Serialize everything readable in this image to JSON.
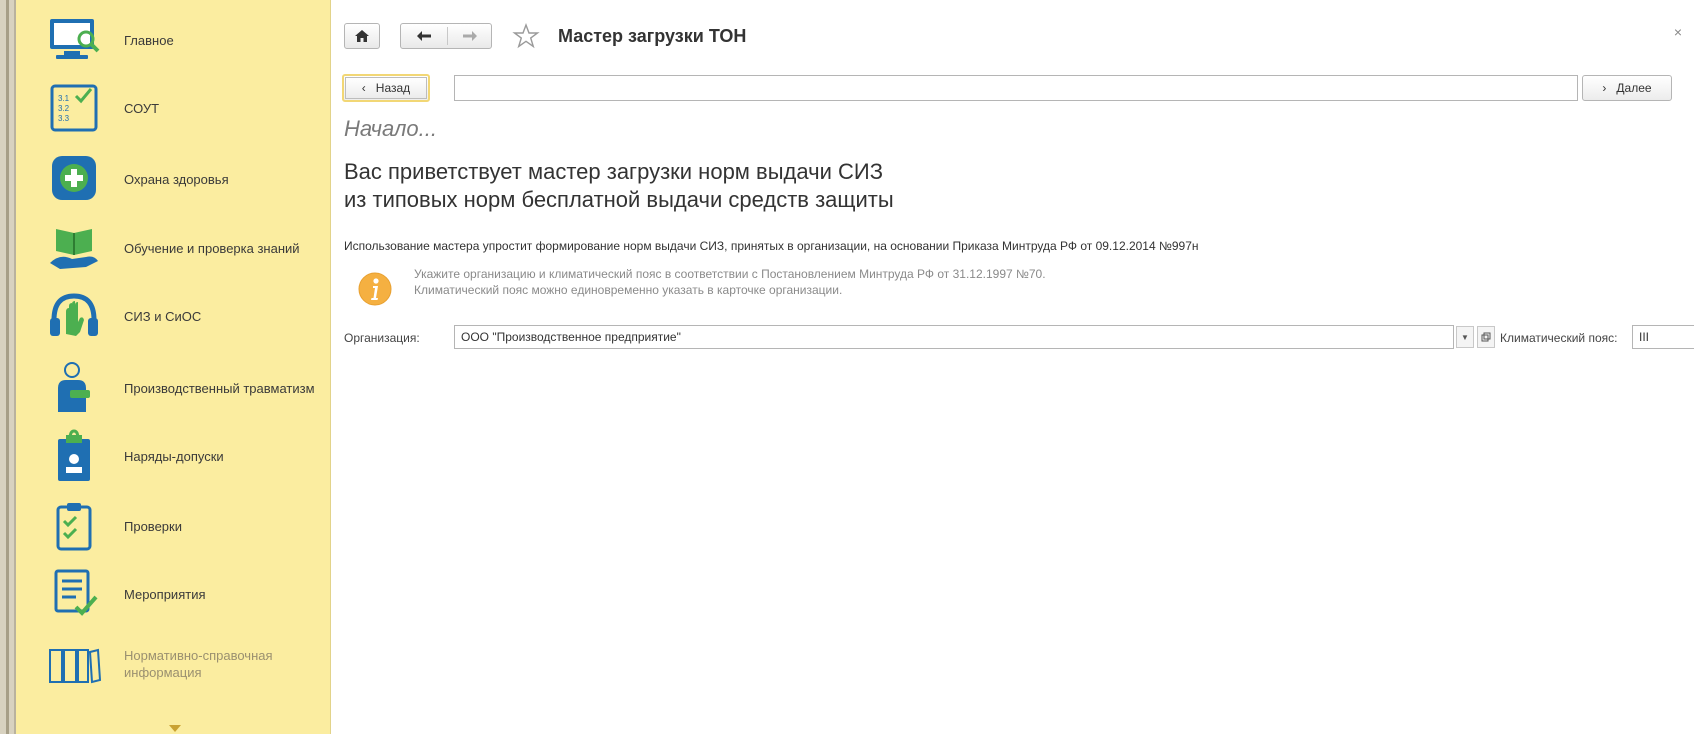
{
  "sidebar": {
    "items": [
      {
        "label": "Главное",
        "icon": "monitor-search-icon"
      },
      {
        "label": "СОУТ",
        "icon": "checklist-numbers-icon"
      },
      {
        "label": "Охрана здоровья",
        "icon": "medical-cross-icon"
      },
      {
        "label": "Обучение и проверка знаний",
        "icon": "book-hand-icon"
      },
      {
        "label": "СИЗ и СиОС",
        "icon": "protection-headphones-icon"
      },
      {
        "label": "Производственный травматизм",
        "icon": "injured-worker-icon"
      },
      {
        "label": "Наряды-допуски",
        "icon": "locked-clipboard-icon"
      },
      {
        "label": "Проверки",
        "icon": "clipboard-check-icon"
      },
      {
        "label": "Мероприятия",
        "icon": "document-check-icon"
      },
      {
        "label": "Нормативно-справочная информация",
        "icon": "binders-icon"
      }
    ]
  },
  "header": {
    "title": "Мастер загрузки ТОН",
    "close_glyph": "×"
  },
  "wizard": {
    "back_label": "Назад",
    "next_label": "Далее",
    "step_title": "Начало...",
    "heading_line1": "Вас приветствует мастер загрузки норм выдачи СИЗ",
    "heading_line2": "из типовых норм бесплатной выдачи средств защиты",
    "description": "Использование мастера упростит формирование норм выдачи СИЗ, принятых в организации, на основании Приказа Минтруда РФ от 09.12.2014 №997н",
    "hint_line1": "Укажите организацию и климатический пояс в соответствии с Постановлением Минтруда РФ от 31.12.1997 №70.",
    "hint_line2": "Климатический пояс можно единовременно указать в карточке организации."
  },
  "form": {
    "org_label": "Организация:",
    "org_value": "ООО \"Производственное предприятие\"",
    "climate_label": "Климатический пояс:",
    "climate_value": "III"
  },
  "colors": {
    "sidebar_bg": "#fbeda0",
    "accent_blue": "#1f6fb2",
    "icon_green": "#4caf50",
    "hint_orange": "#f5b041"
  }
}
